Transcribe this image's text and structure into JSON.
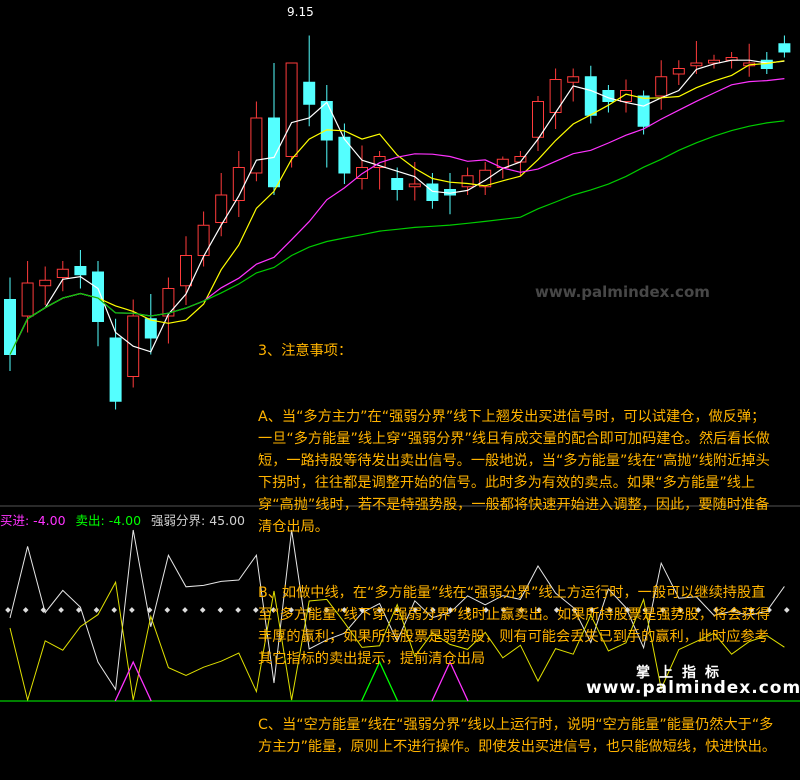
{
  "chart_data": [
    {
      "type": "candlestick",
      "peak_label": "9.15",
      "candles": [
        {
          "o": 8.12,
          "c": 7.92,
          "h": 8.2,
          "l": 7.86,
          "dir": "down"
        },
        {
          "o": 8.06,
          "c": 8.18,
          "h": 8.26,
          "l": 8.0,
          "dir": "up"
        },
        {
          "o": 8.19,
          "c": 8.17,
          "h": 8.24,
          "l": 8.1,
          "dir": "up"
        },
        {
          "o": 8.2,
          "c": 8.23,
          "h": 8.26,
          "l": 8.15,
          "dir": "up"
        },
        {
          "o": 8.24,
          "c": 8.21,
          "h": 8.3,
          "l": 8.16,
          "dir": "down"
        },
        {
          "o": 8.22,
          "c": 8.04,
          "h": 8.26,
          "l": 7.95,
          "dir": "down"
        },
        {
          "o": 7.98,
          "c": 7.75,
          "h": 8.05,
          "l": 7.72,
          "dir": "down"
        },
        {
          "o": 7.84,
          "c": 8.06,
          "h": 8.12,
          "l": 7.8,
          "dir": "up"
        },
        {
          "o": 8.05,
          "c": 7.98,
          "h": 8.14,
          "l": 7.92,
          "dir": "down"
        },
        {
          "o": 8.06,
          "c": 8.16,
          "h": 8.2,
          "l": 7.96,
          "dir": "up"
        },
        {
          "o": 8.17,
          "c": 8.28,
          "h": 8.35,
          "l": 8.1,
          "dir": "up"
        },
        {
          "o": 8.28,
          "c": 8.39,
          "h": 8.44,
          "l": 8.24,
          "dir": "up"
        },
        {
          "o": 8.4,
          "c": 8.5,
          "h": 8.58,
          "l": 8.35,
          "dir": "up"
        },
        {
          "o": 8.48,
          "c": 8.6,
          "h": 8.66,
          "l": 8.42,
          "dir": "up"
        },
        {
          "o": 8.58,
          "c": 8.78,
          "h": 8.84,
          "l": 8.55,
          "dir": "up"
        },
        {
          "o": 8.78,
          "c": 8.53,
          "h": 8.98,
          "l": 8.5,
          "dir": "down"
        },
        {
          "o": 8.64,
          "c": 8.98,
          "h": 8.98,
          "l": 8.6,
          "dir": "up"
        },
        {
          "o": 8.91,
          "c": 8.83,
          "h": 9.08,
          "l": 8.75,
          "dir": "down"
        },
        {
          "o": 8.84,
          "c": 8.7,
          "h": 8.9,
          "l": 8.6,
          "dir": "down"
        },
        {
          "o": 8.71,
          "c": 8.58,
          "h": 8.76,
          "l": 8.54,
          "dir": "down"
        },
        {
          "o": 8.56,
          "c": 8.6,
          "h": 8.68,
          "l": 8.52,
          "dir": "up"
        },
        {
          "o": 8.6,
          "c": 8.64,
          "h": 8.66,
          "l": 8.52,
          "dir": "up"
        },
        {
          "o": 8.56,
          "c": 8.52,
          "h": 8.6,
          "l": 8.48,
          "dir": "down"
        },
        {
          "o": 8.53,
          "c": 8.54,
          "h": 8.62,
          "l": 8.48,
          "dir": "up"
        },
        {
          "o": 8.54,
          "c": 8.48,
          "h": 8.58,
          "l": 8.45,
          "dir": "down"
        },
        {
          "o": 8.52,
          "c": 8.5,
          "h": 8.58,
          "l": 8.43,
          "dir": "down"
        },
        {
          "o": 8.53,
          "c": 8.57,
          "h": 8.6,
          "l": 8.5,
          "dir": "up"
        },
        {
          "o": 8.53,
          "c": 8.59,
          "h": 8.62,
          "l": 8.5,
          "dir": "up"
        },
        {
          "o": 8.6,
          "c": 8.63,
          "h": 8.64,
          "l": 8.56,
          "dir": "up"
        },
        {
          "o": 8.62,
          "c": 8.64,
          "h": 8.66,
          "l": 8.57,
          "dir": "up"
        },
        {
          "o": 8.71,
          "c": 8.84,
          "h": 8.86,
          "l": 8.66,
          "dir": "up"
        },
        {
          "o": 8.8,
          "c": 8.92,
          "h": 8.96,
          "l": 8.74,
          "dir": "up"
        },
        {
          "o": 8.91,
          "c": 8.93,
          "h": 8.96,
          "l": 8.84,
          "dir": "up"
        },
        {
          "o": 8.93,
          "c": 8.79,
          "h": 8.97,
          "l": 8.76,
          "dir": "down"
        },
        {
          "o": 8.88,
          "c": 8.84,
          "h": 8.9,
          "l": 8.8,
          "dir": "down"
        },
        {
          "o": 8.84,
          "c": 8.88,
          "h": 8.92,
          "l": 8.8,
          "dir": "up"
        },
        {
          "o": 8.86,
          "c": 8.75,
          "h": 8.88,
          "l": 8.72,
          "dir": "down"
        },
        {
          "o": 8.86,
          "c": 8.93,
          "h": 8.99,
          "l": 8.81,
          "dir": "up"
        },
        {
          "o": 8.94,
          "c": 8.96,
          "h": 8.99,
          "l": 8.9,
          "dir": "up"
        },
        {
          "o": 8.97,
          "c": 8.98,
          "h": 9.06,
          "l": 8.94,
          "dir": "up"
        },
        {
          "o": 8.98,
          "c": 8.99,
          "h": 9.01,
          "l": 8.96,
          "dir": "up"
        },
        {
          "o": 8.99,
          "c": 9.0,
          "h": 9.02,
          "l": 8.96,
          "dir": "up"
        },
        {
          "o": 8.97,
          "c": 8.98,
          "h": 9.05,
          "l": 8.93,
          "dir": "up"
        },
        {
          "o": 8.99,
          "c": 8.96,
          "h": 9.02,
          "l": 8.94,
          "dir": "down"
        },
        {
          "o": 9.05,
          "c": 9.02,
          "h": 9.08,
          "l": 9.0,
          "dir": "down"
        }
      ]
    },
    {
      "type": "line",
      "legend": [
        {
          "label": "买进: -4.00",
          "color": "#ff33ff"
        },
        {
          "label": "卖出: -4.00",
          "color": "#00ff00"
        },
        {
          "label": "强弱分界: 45.00",
          "color": "#d0d0d0"
        }
      ],
      "signals": [
        {
          "index": 7,
          "color": "#ff33ff"
        },
        {
          "index": 21,
          "color": "#00ff00"
        },
        {
          "index": 25,
          "color": "#ff33ff"
        }
      ]
    }
  ],
  "note": {
    "lines": [
      "3、注意事项：",
      "A、当“多方主力”在“强弱分界”线下上翘发出买进信号时，可以试建仓，做反弹；一旦“多方能量”线上穿“强弱分界”线且有成交量的配合即可加码建仓。然后看长做短，一路持股等待发出卖出信号。一般地说，当“多方能量”线在“高抛”线附近掉头下拐时，往往都是调整开始的信号。此时多为有效的卖点。如果“多方能量”线上穿“高抛”线时，若不是特强势股，一般都将快速开始进入调整，因此，要随时准备清仓出局。",
      "B、如做中线，在“多方能量”线在“强弱分界”线上方运行时，一般可以继续持股直至“多方能量”线下穿“强弱分界”线时止赢卖出。如果所持股票是强势股，将会获得丰厚的赢利；如果所持股票是弱势股，则有可能会丢失已到手的赢利，此时应参考其它指标的卖出提示，提前清仓出局",
      "C、当“空方能量”线在“强弱分界”线以上运行时，说明“空方能量”能量仍然大于“多方主力”能量，原则上不进行操作。即使发出买进信号，也只能做短线，快进快出。"
    ]
  },
  "watermark": {
    "cn": "掌上指标",
    "url": "www.palmindex.com",
    "faint_url": "www.palmindex.com"
  }
}
